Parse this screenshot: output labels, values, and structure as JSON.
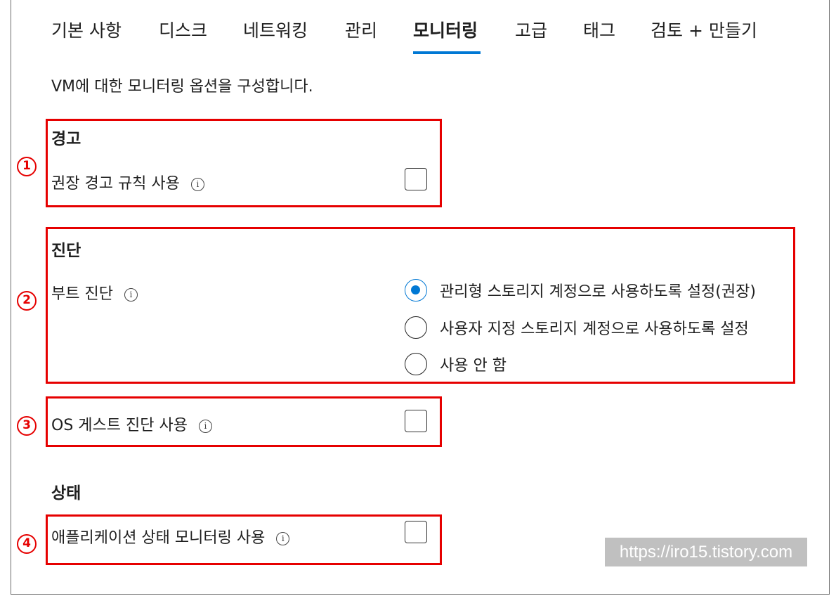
{
  "tabs": [
    {
      "label": "기본 사항",
      "active": false
    },
    {
      "label": "디스크",
      "active": false
    },
    {
      "label": "네트워킹",
      "active": false
    },
    {
      "label": "관리",
      "active": false
    },
    {
      "label": "모니터링",
      "active": true
    },
    {
      "label": "고급",
      "active": false
    },
    {
      "label": "태그",
      "active": false
    },
    {
      "label": "검토 + 만들기",
      "active": false
    }
  ],
  "description": "VM에 대한 모니터링 옵션을 구성합니다.",
  "alerts": {
    "title": "경고",
    "recommended_rules_label": "권장 경고 규칙 사용",
    "recommended_rules_checked": false
  },
  "diagnostics": {
    "title": "진단",
    "boot_label": "부트 진단",
    "options": [
      {
        "label": "관리형 스토리지 계정으로 사용하도록 설정(권장)",
        "selected": true
      },
      {
        "label": "사용자 지정 스토리지 계정으로 사용하도록 설정",
        "selected": false
      },
      {
        "label": "사용 안 함",
        "selected": false
      }
    ],
    "os_guest_label": "OS 게스트 진단 사용",
    "os_guest_checked": false
  },
  "health": {
    "title": "상태",
    "app_health_label": "애플리케이션 상태 모니터링 사용",
    "app_health_checked": false
  },
  "markers": [
    "1",
    "2",
    "3",
    "4"
  ],
  "info_glyph": "i",
  "watermark": "https://iro15.tistory.com",
  "colors": {
    "accent": "#0078d4",
    "annotation": "#e60000",
    "watermark_bg": "#c0c0c0"
  }
}
